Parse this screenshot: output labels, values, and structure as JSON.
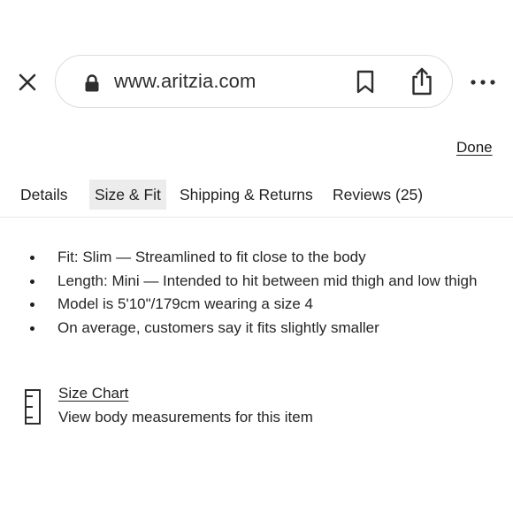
{
  "browser": {
    "url": "www.aritzia.com",
    "icons": {
      "close": "close-icon",
      "lock": "lock-icon",
      "bookmark": "bookmark-icon",
      "share": "share-icon",
      "more": "more-icon"
    }
  },
  "panel": {
    "done_label": "Done",
    "tabs": [
      {
        "label": "Details",
        "active": false
      },
      {
        "label": "Size & Fit",
        "active": true
      },
      {
        "label": "Shipping & Returns",
        "active": false
      },
      {
        "label": "Reviews (25)",
        "active": false
      }
    ],
    "fit_items": [
      "Fit: Slim — Streamlined to fit close to the body",
      "Length: Mini — Intended to hit between mid thigh and low thigh",
      "Model is 5'10\"/179cm wearing a size 4",
      "On average, customers say it fits slightly smaller"
    ],
    "size_chart": {
      "link_label": "Size Chart",
      "description": "View body measurements for this item",
      "icon": "ruler-icon"
    }
  },
  "colors": {
    "text": "#262626",
    "border": "#dcdcdc",
    "active_tab_bg": "#ececec"
  }
}
